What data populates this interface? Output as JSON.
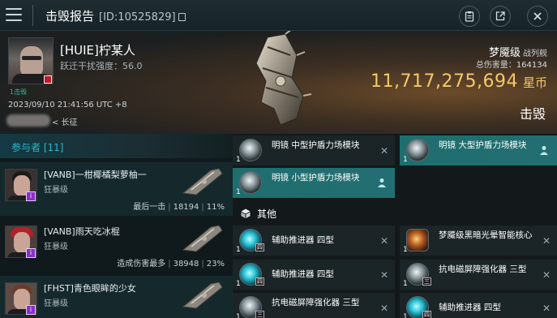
{
  "topbar": {
    "title": "击毁报告",
    "report_id": "[ID:10525829]"
  },
  "victim": {
    "name": "[HUIE]柠某人",
    "stat": "跃迁干扰强度：56.0",
    "corp_small": "1击毁",
    "time": "2023/09/10 21:41:56 UTC +8",
    "extra_link": "< 长征"
  },
  "ship": {
    "name": "梦魇级",
    "class": "战列舰",
    "total_damage_label": "总伤害量：",
    "total_damage": "164134",
    "isk_value": "11,717,275,694",
    "isk_unit": "星币",
    "result": "击毁"
  },
  "participants": {
    "header": "参与者 [11]",
    "rows": [
      {
        "name": "[VANB]一柑椰橘梨萝柚一",
        "ship": "狂暴级",
        "stat_label": "最后一击",
        "damage": "18194",
        "percent": "11%"
      },
      {
        "name": "[VANB]雨天吃冰棍",
        "ship": "狂暴级",
        "stat_label": "造成伤害最多",
        "damage": "38948",
        "percent": "23%"
      },
      {
        "name": "[FHST]青色眼眸的少女",
        "ship": "狂暴级"
      }
    ]
  },
  "modules": {
    "fitted": [
      {
        "name": "明镜 中型护盾力场模块",
        "qty": "1"
      },
      {
        "name": "明镜 大型护盾力场模块",
        "qty": "1"
      },
      {
        "name": "明镜 小型护盾力场模块",
        "qty": "1"
      }
    ],
    "other_label": "其他",
    "other": [
      {
        "name": "辅助推进器 四型",
        "qty": "1",
        "tier": "四"
      },
      {
        "name": "梦魇级黑暗光晕智能核心",
        "qty": "1"
      },
      {
        "name": "辅助推进器 四型",
        "qty": "1",
        "tier": "四"
      },
      {
        "name": "抗电磁屏障强化器 三型",
        "qty": "1",
        "tier": "三"
      },
      {
        "name": "抗电磁屏障强化器 三型",
        "qty": "1",
        "tier": "三"
      },
      {
        "name": "辅助推进器 四型",
        "qty": "1",
        "tier": "四"
      }
    ]
  },
  "colors": {
    "accent": "#2fb6c9",
    "isk_gold": "#f4c86a",
    "highlight_row": "#1f6e6e"
  }
}
